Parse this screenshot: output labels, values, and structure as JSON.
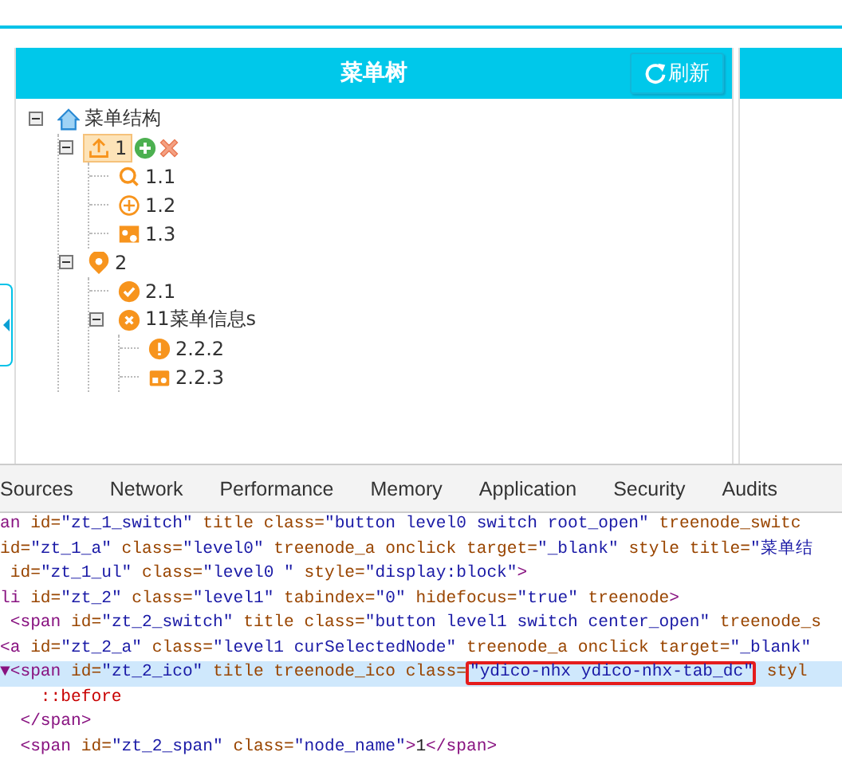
{
  "panel": {
    "title": "菜单树",
    "refresh_button": "刷新"
  },
  "tree": [
    {
      "label": "菜单结构",
      "kind": "home",
      "selected": false,
      "expanded": true,
      "children": [
        {
          "label": "1",
          "kind": "upload",
          "selected": true,
          "expanded": true,
          "children": [
            {
              "label": "1.1",
              "kind": "search",
              "selected": false
            },
            {
              "label": "1.2",
              "kind": "plus",
              "selected": false
            },
            {
              "label": "1.3",
              "kind": "card",
              "selected": false
            }
          ]
        },
        {
          "label": "2",
          "kind": "pin",
          "selected": false,
          "expanded": true,
          "children": [
            {
              "label": "2.1",
              "kind": "check",
              "selected": false
            },
            {
              "label": "11菜单信息s",
              "kind": "cross",
              "selected": false,
              "expanded": true,
              "children": [
                {
                  "label": "2.2.2",
                  "kind": "alert",
                  "selected": false
                },
                {
                  "label": "2.2.3",
                  "kind": "lock",
                  "selected": false
                }
              ]
            }
          ]
        }
      ]
    }
  ],
  "devtools": {
    "tabs": [
      {
        "label": "Sources",
        "selected": false
      },
      {
        "label": "Network",
        "selected": false
      },
      {
        "label": "Performance",
        "selected": false
      },
      {
        "label": "Memory",
        "selected": false
      },
      {
        "label": "Application",
        "selected": false
      },
      {
        "label": "Security",
        "selected": false
      },
      {
        "label": "Audits",
        "selected": false
      }
    ],
    "lines": [
      {
        "selected": false,
        "tokens": [
          {
            "kind": "tag",
            "text": "an "
          },
          {
            "kind": "attr",
            "text": "id="
          },
          {
            "kind": "val",
            "text": "\"zt_1_switch\" "
          },
          {
            "kind": "attr",
            "text": "title class="
          },
          {
            "kind": "val",
            "text": "\"button level0 switch root_open\" "
          },
          {
            "kind": "attr",
            "text": "treenode_switc"
          }
        ]
      },
      {
        "selected": false,
        "tokens": [
          {
            "kind": "attr",
            "text": "id="
          },
          {
            "kind": "val",
            "text": "\"zt_1_a\" "
          },
          {
            "kind": "attr",
            "text": "class="
          },
          {
            "kind": "val",
            "text": "\"level0\" "
          },
          {
            "kind": "attr",
            "text": "treenode_a onclick target="
          },
          {
            "kind": "val",
            "text": "\"_blank\" "
          },
          {
            "kind": "attr",
            "text": "style title="
          },
          {
            "kind": "val",
            "text": "\"菜单结"
          }
        ]
      },
      {
        "selected": false,
        "tokens": [
          {
            "kind": "attr",
            "text": " id="
          },
          {
            "kind": "val",
            "text": "\"zt_1_ul\" "
          },
          {
            "kind": "attr",
            "text": "class="
          },
          {
            "kind": "val",
            "text": "\"level0 \" "
          },
          {
            "kind": "attr",
            "text": "style="
          },
          {
            "kind": "val",
            "text": "\"display:block\""
          },
          {
            "kind": "tag",
            "text": ">"
          }
        ]
      },
      {
        "selected": false,
        "tokens": [
          {
            "kind": "tag",
            "text": "li "
          },
          {
            "kind": "attr",
            "text": "id="
          },
          {
            "kind": "val",
            "text": "\"zt_2\" "
          },
          {
            "kind": "attr",
            "text": "class="
          },
          {
            "kind": "val",
            "text": "\"level1\" "
          },
          {
            "kind": "attr",
            "text": "tabindex="
          },
          {
            "kind": "val",
            "text": "\"0\" "
          },
          {
            "kind": "attr",
            "text": "hidefocus="
          },
          {
            "kind": "val",
            "text": "\"true\" "
          },
          {
            "kind": "attr",
            "text": "treenode"
          },
          {
            "kind": "tag",
            "text": ">"
          }
        ]
      },
      {
        "selected": false,
        "tokens": [
          {
            "kind": "tag",
            "text": " <span "
          },
          {
            "kind": "attr",
            "text": "id="
          },
          {
            "kind": "val",
            "text": "\"zt_2_switch\" "
          },
          {
            "kind": "attr",
            "text": "title class="
          },
          {
            "kind": "val",
            "text": "\"button level1 switch center_open\" "
          },
          {
            "kind": "attr",
            "text": "treenode_s"
          }
        ]
      },
      {
        "selected": false,
        "tokens": [
          {
            "kind": "tag",
            "text": "<a "
          },
          {
            "kind": "attr",
            "text": "id="
          },
          {
            "kind": "val",
            "text": "\"zt_2_a\" "
          },
          {
            "kind": "attr",
            "text": "class="
          },
          {
            "kind": "val",
            "text": "\"level1 curSelectedNode\" "
          },
          {
            "kind": "attr",
            "text": "treenode_a onclick target="
          },
          {
            "kind": "val",
            "text": "\"_blank\""
          }
        ]
      },
      {
        "selected": true,
        "tokens": [
          {
            "kind": "tag",
            "text": "▼<span "
          },
          {
            "kind": "attr",
            "text": "id="
          },
          {
            "kind": "val",
            "text": "\"zt_2_ico\" "
          },
          {
            "kind": "attr",
            "text": "title treenode_ico class="
          },
          {
            "kind": "boxed",
            "text": "\"ydico-nhx ydico-nhx-tab_dc\""
          },
          {
            "kind": "attr",
            "text": " styl"
          }
        ]
      },
      {
        "selected": false,
        "tokens": [
          {
            "kind": "pseudo",
            "text": "    ::before"
          }
        ]
      },
      {
        "selected": false,
        "tokens": [
          {
            "kind": "tag",
            "text": "  </span>"
          }
        ]
      },
      {
        "selected": false,
        "tokens": [
          {
            "kind": "tag",
            "text": "  <span "
          },
          {
            "kind": "attr",
            "text": "id="
          },
          {
            "kind": "val",
            "text": "\"zt_2_span\" "
          },
          {
            "kind": "attr",
            "text": "class="
          },
          {
            "kind": "val",
            "text": "\"node_name\""
          },
          {
            "kind": "tag",
            "text": ">"
          },
          {
            "kind": "text",
            "text": "1"
          },
          {
            "kind": "tag",
            "text": "</span>"
          }
        ]
      }
    ]
  }
}
